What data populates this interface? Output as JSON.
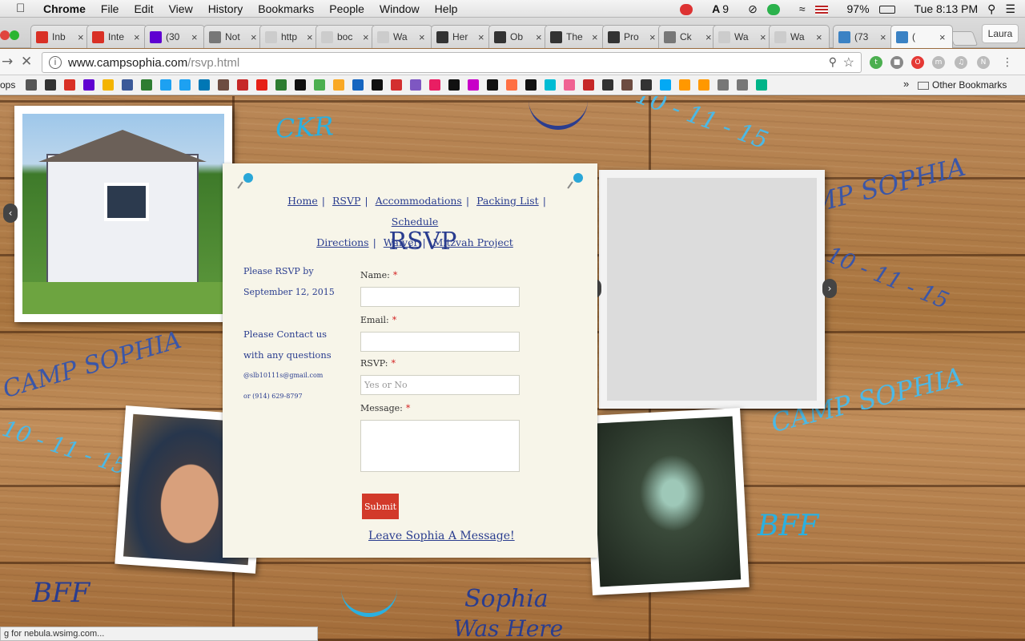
{
  "menubar": {
    "app": "Chrome",
    "items": [
      "File",
      "Edit",
      "View",
      "History",
      "Bookmarks",
      "People",
      "Window",
      "Help"
    ],
    "badge_count": "9",
    "battery": "97%",
    "clock": "Tue 8:13 PM"
  },
  "tabs": [
    {
      "label": "Inb",
      "icon": "gmail-icon",
      "color": "#d93025"
    },
    {
      "label": "Inte",
      "icon": "gmail-icon",
      "color": "#d93025"
    },
    {
      "label": "(30",
      "icon": "yahoo-mail-icon",
      "color": "#5f01d1"
    },
    {
      "label": "Not",
      "icon": "document-icon",
      "color": "#777777"
    },
    {
      "label": "http",
      "icon": "blank-icon",
      "color": "#cccccc"
    },
    {
      "label": "boc",
      "icon": "blank-icon",
      "color": "#cccccc"
    },
    {
      "label": "Wa",
      "icon": "blank-icon",
      "color": "#cccccc"
    },
    {
      "label": "Her",
      "icon": "wikipedia-icon",
      "color": "#333333"
    },
    {
      "label": "Ob",
      "icon": "wikipedia-icon",
      "color": "#333333"
    },
    {
      "label": "The",
      "icon": "wikipedia-icon",
      "color": "#333333"
    },
    {
      "label": "Pro",
      "icon": "wikipedia-icon",
      "color": "#333333"
    },
    {
      "label": "Ck",
      "icon": "document-icon",
      "color": "#777777"
    },
    {
      "label": "Wa",
      "icon": "blank-icon",
      "color": "#cccccc"
    },
    {
      "label": "Wa",
      "icon": "blank-icon",
      "color": "#cccccc"
    },
    {
      "label": "(73",
      "icon": "bird-icon",
      "color": "#3b82c4"
    },
    {
      "label": "(",
      "icon": "loading-icon",
      "color": "#3b82c4",
      "active": true
    }
  ],
  "profile": "Laura",
  "address": {
    "host": "www.campsophia.com",
    "path": "/rsvp.html"
  },
  "bookmarks": {
    "left_label": "ops",
    "other": "Other Bookmarks"
  },
  "site": {
    "deco": {
      "ckr": "CKR",
      "date1": "10 - 11 - 15",
      "camp1": "MP SOPHIA",
      "camp2": "CAMP SOPHIA",
      "camp3": "CAMP SOPHIA",
      "date2": "10 - 11 - 15",
      "date3": "10 - 11 - 15",
      "bff1": "BFF",
      "bff2": "BFF",
      "sophia": "Sophia",
      "washere": "Was Here"
    },
    "nav": [
      "Home",
      "RSVP",
      "Accommodations",
      "Packing List",
      "Schedule",
      "Directions",
      "Waiver",
      "Mitzvah Project"
    ],
    "title": "RSVP",
    "sidebar": {
      "rsvp_by_1": "Please RSVP by",
      "rsvp_by_2": "September 12, 2015",
      "contact_1": "Please Contact us",
      "contact_2": "with any questions",
      "email": "@slb10111s@gmail.com",
      "phone": "or (914) 629-8797"
    },
    "form": {
      "name_label": "Name:",
      "email_label": "Email:",
      "rsvp_label": "RSVP:",
      "rsvp_placeholder": "Yes or No",
      "message_label": "Message:",
      "required_mark": "*",
      "submit": "Submit",
      "leave_message": "Leave Sophia A Message!"
    }
  },
  "status": "g for nebula.wsimg.com..."
}
